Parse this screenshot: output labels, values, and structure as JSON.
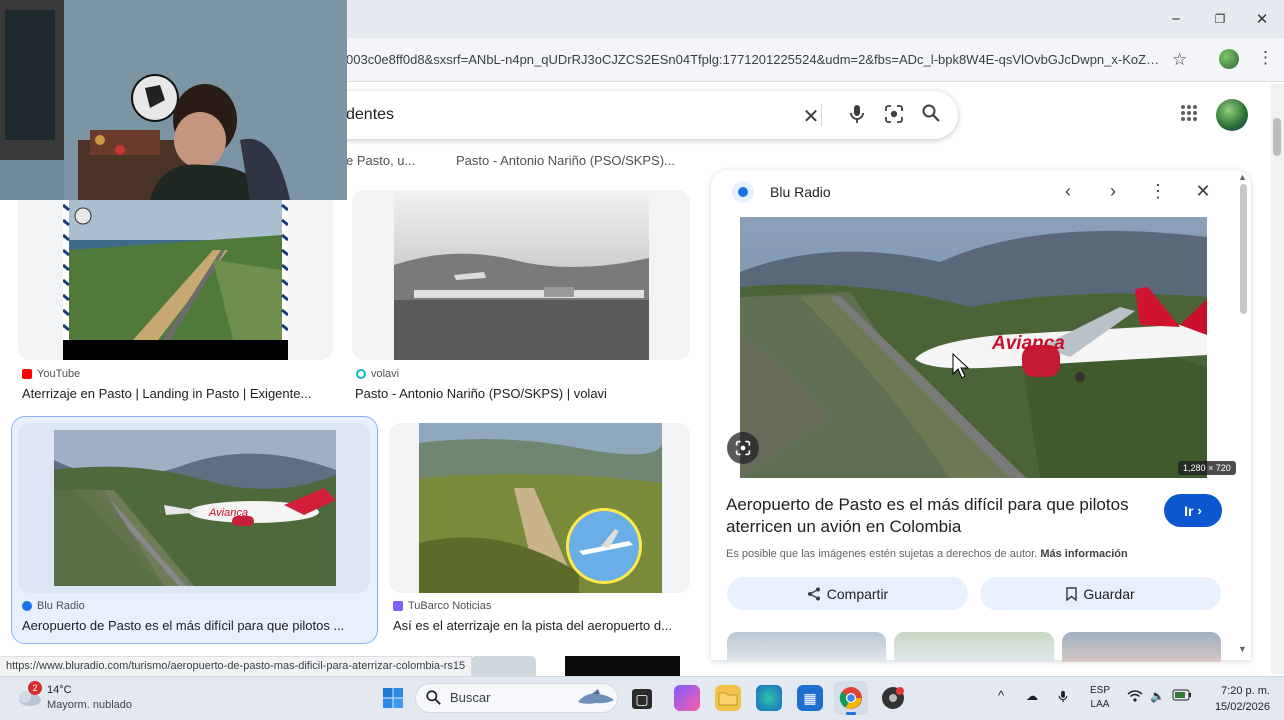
{
  "browser": {
    "url": "003c0e8ff0d8&sxsrf=ANbL-n4pn_qUDrRJ3oCJZCS2ESn04Tfplg:1771201225524&udm=2&fbs=ADc_l-bpk8W4E-qsVlOvbGJcDwpn_x-KoZgS_...",
    "window_buttons": [
      "−",
      "❐",
      "✕"
    ]
  },
  "search": {
    "query_partial": "dentes"
  },
  "results": {
    "top_captions": [
      "e Pasto, u...",
      "Pasto - Antonio Nariño (PSO/SKPS)..."
    ],
    "cards": [
      {
        "source": "YouTube",
        "title": "Aterrizaje en Pasto | Landing in Pasto | Exigente...",
        "favicon_color": "#ff0000"
      },
      {
        "source": "volavi",
        "title": "Pasto - Antonio Nariño (PSO/SKPS) | volavi",
        "favicon_color": "#12b5cb"
      },
      {
        "source": "Blu Radio",
        "title": "Aeropuerto de Pasto es el más difícil para que pilotos ...",
        "favicon_color": "#1a73e8"
      },
      {
        "source": "TuBarco Noticias",
        "title": "Así es el aterrizaje en la pista del aeropuerto d...",
        "favicon_color": "#7b61ff"
      }
    ]
  },
  "panel": {
    "source": "Blu Radio",
    "image_size": "1,280 × 720",
    "title": "Aeropuerto de Pasto es el más difícil para que pilotos aterricen un avión en Colombia",
    "go_button": "Ir",
    "copyright_text": "Es posible que las imágenes estén sujetas a derechos de autor.",
    "more_info": "Más información",
    "share_label": "Compartir",
    "save_label": "Guardar",
    "plane_brand": "Avianca"
  },
  "status_url": "https://www.bluradio.com/turismo/aeropuerto-de-pasto-mas-dificil-para-aterrizar-colombia-rs15",
  "taskbar": {
    "weather_badge": "2",
    "temperature": "14°C",
    "weather_desc": "Mayorm. nublado",
    "search_label": "Buscar",
    "lang_top": "ESP",
    "lang_bottom": "LAA",
    "time": "7:20 p. m.",
    "date": "15/02/2026"
  }
}
